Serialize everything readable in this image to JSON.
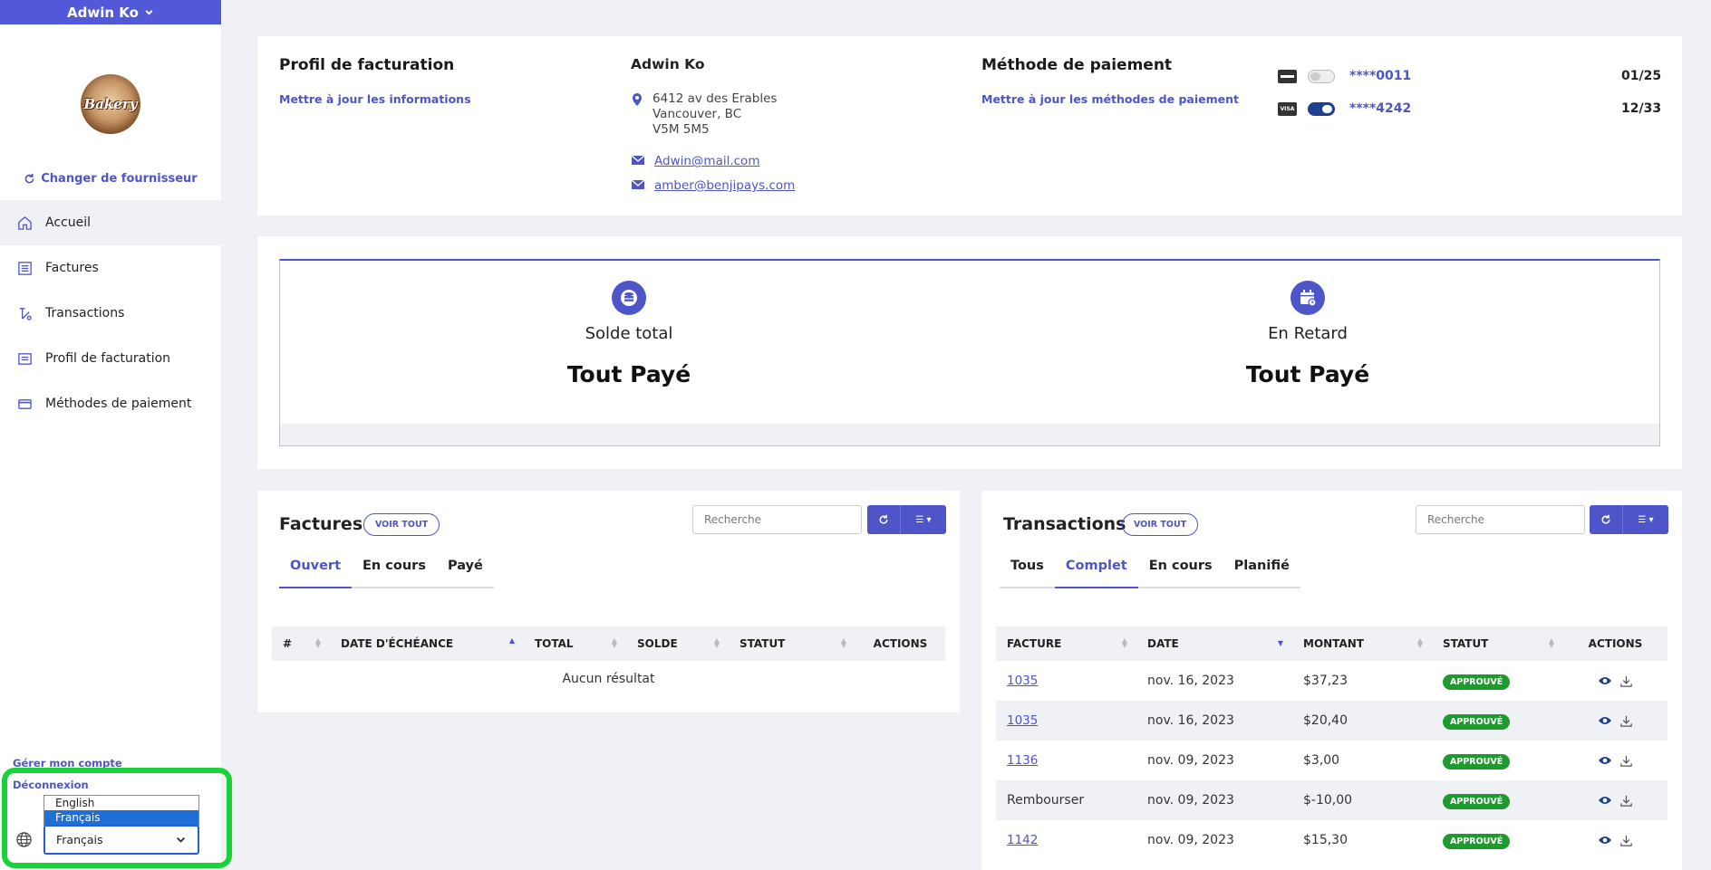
{
  "user": {
    "name": "Adwin Ko"
  },
  "logo": {
    "text": "Bakery"
  },
  "sidebar": {
    "change_supplier": "Changer de fournisseur",
    "items": [
      {
        "label": "Accueil",
        "icon": "home-icon"
      },
      {
        "label": "Factures",
        "icon": "invoice-icon"
      },
      {
        "label": "Transactions",
        "icon": "transactions-icon"
      },
      {
        "label": "Profil de facturation",
        "icon": "profile-icon"
      },
      {
        "label": "Méthodes de paiement",
        "icon": "card-icon"
      }
    ],
    "manage_account": "Gérer mon compte",
    "logout": "Déconnexion",
    "language": {
      "options": [
        "English",
        "Français"
      ],
      "selected": "Français"
    }
  },
  "billing": {
    "title": "Profil de facturation",
    "update_link": "Mettre à jour les informations",
    "name": "Adwin Ko",
    "address_line1": "6412 av des Erables",
    "address_line2": "Vancouver, BC",
    "address_line3": "V5M 5M5",
    "email1": "Adwin@mail.com",
    "email2": "amber@benjipays.com"
  },
  "payment": {
    "title": "Méthode de paiement",
    "update_link": "Mettre à jour les méthodes de paiement",
    "cards": [
      {
        "brand": "",
        "masked": "****0011",
        "expiry": "01/25",
        "enabled": false
      },
      {
        "brand": "VISA",
        "masked": "****4242",
        "expiry": "12/33",
        "enabled": true
      }
    ]
  },
  "summary": {
    "total_label": "Solde total",
    "total_value": "Tout Payé",
    "late_label": "En Retard",
    "late_value": "Tout Payé"
  },
  "invoices": {
    "title": "Factures",
    "view_all": "VOIR TOUT",
    "search_placeholder": "Recherche",
    "tabs": [
      "Ouvert",
      "En cours",
      "Payé"
    ],
    "columns": [
      "#",
      "DATE D'ÉCHÉANCE",
      "TOTAL",
      "SOLDE",
      "STATUT",
      "ACTIONS"
    ],
    "empty": "Aucun résultat"
  },
  "transactions": {
    "title": "Transactions",
    "view_all": "VOIR TOUT",
    "search_placeholder": "Recherche",
    "tabs": [
      "Tous",
      "Complet",
      "En cours",
      "Planifié"
    ],
    "columns": [
      "FACTURE",
      "DATE",
      "MONTANT",
      "STATUT",
      "ACTIONS"
    ],
    "rows": [
      {
        "invoice": "1035",
        "date": "nov. 16, 2023",
        "amount": "$37,23",
        "status": "APPROUVÉ"
      },
      {
        "invoice": "1035",
        "date": "nov. 16, 2023",
        "amount": "$20,40",
        "status": "APPROUVÉ"
      },
      {
        "invoice": "1136",
        "date": "nov. 09, 2023",
        "amount": "$3,00",
        "status": "APPROUVÉ"
      },
      {
        "invoice": "Rembourser",
        "date": "nov. 09, 2023",
        "amount": "$-10,00",
        "status": "APPROUVÉ"
      },
      {
        "invoice": "1142",
        "date": "nov. 09, 2023",
        "amount": "$15,30",
        "status": "APPROUVÉ"
      }
    ]
  },
  "colors": {
    "accent": "#4d55c8",
    "success": "#1e9a2f",
    "highlight": "#19d23a"
  }
}
